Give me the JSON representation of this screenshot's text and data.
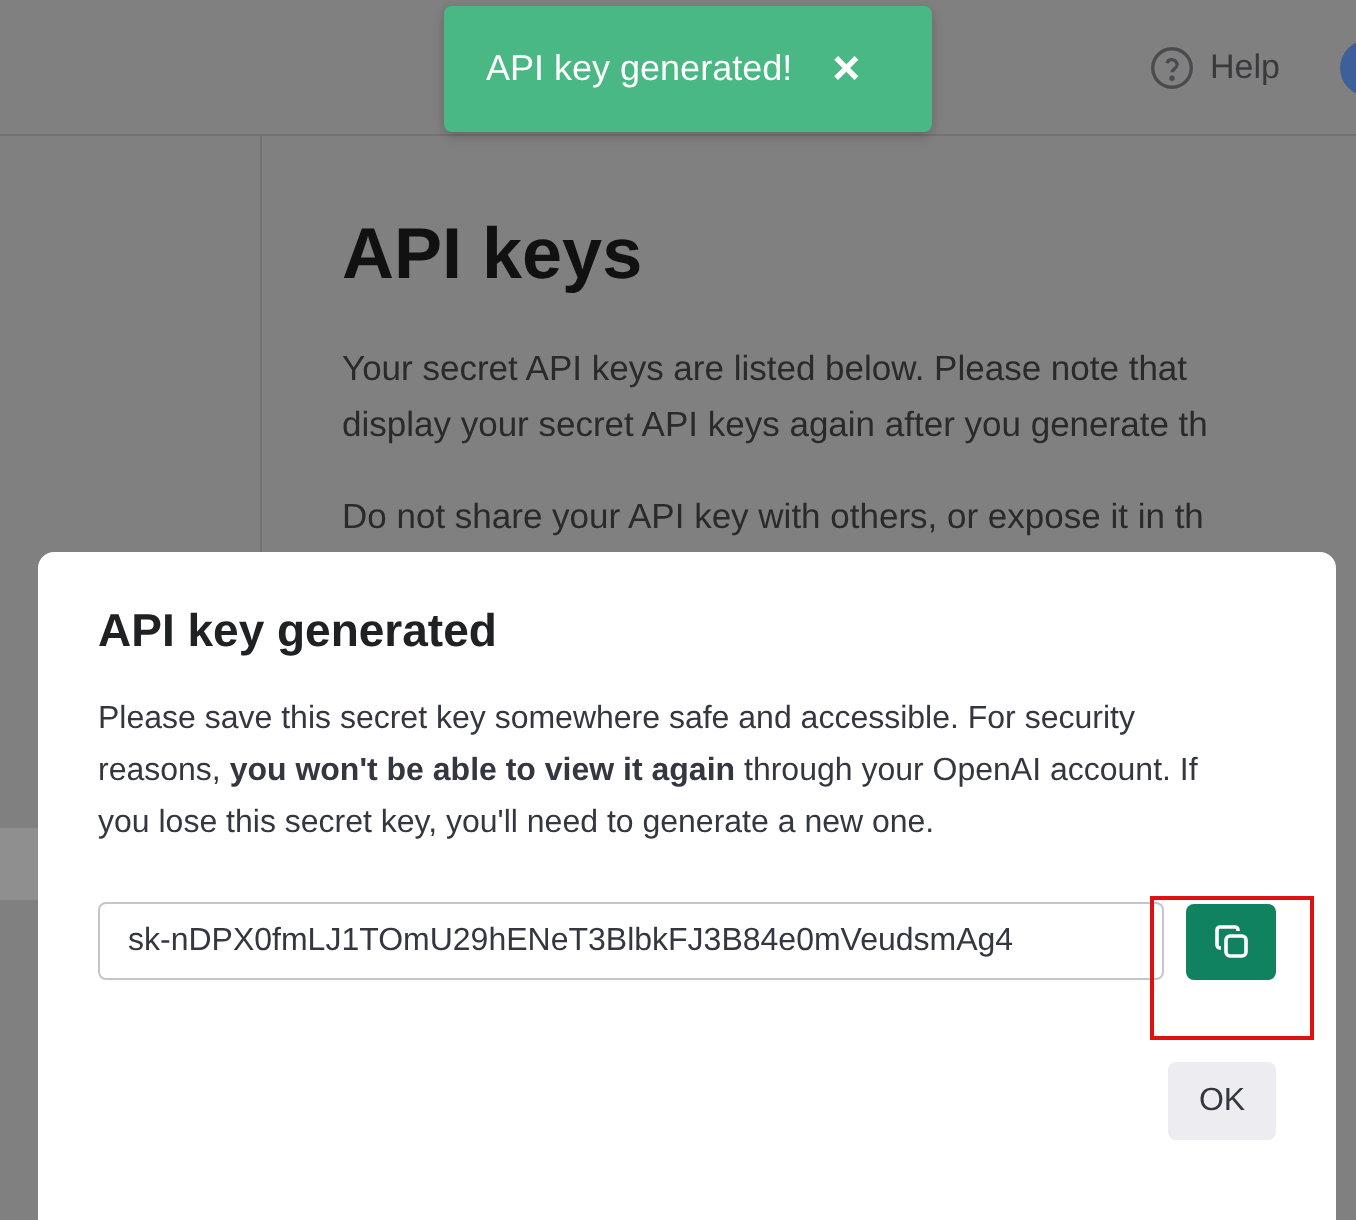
{
  "header": {
    "help": "Help"
  },
  "toast": {
    "message": "API key generated!",
    "close": "×"
  },
  "page": {
    "title": "API keys",
    "paragraphs": [
      [
        "Your secret API keys are listed below. Please note that",
        "display your secret API keys again after you generate th"
      ],
      [
        "Do not share your API key with others, or expose it in th"
      ]
    ]
  },
  "modal": {
    "title": "API key generated",
    "body": "Please save this secret key somewhere safe and accessible. For security reasons, **you won't be able to view it again** through your OpenAI account. If you lose this secret key, you'll need to generate a new one.",
    "key_value": "sk-nDPX0fmLJ1TOmU29hENeT3BlbkFJ3B84e0mVeudsmAg4",
    "ok_button": "OK"
  }
}
